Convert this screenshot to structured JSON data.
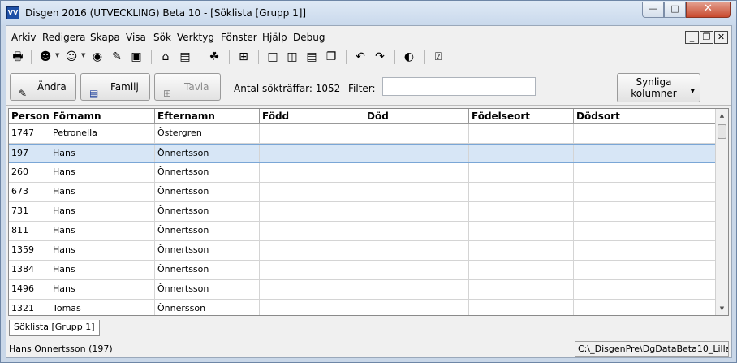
{
  "window": {
    "app_icon": "VV",
    "title": "Disgen 2016 (UTVECKLING) Beta 10 - [Söklista [Grupp 1]]"
  },
  "menu": [
    "Arkiv",
    "Redigera",
    "Skapa",
    "Visa",
    "Sök",
    "Verktyg",
    "Fönster",
    "Hjälp",
    "Debug"
  ],
  "actions": {
    "andra": "Ändra",
    "familj": "Familj",
    "tavla": "Tavla",
    "hits": "Antal sökträffar: 1052",
    "filter_label": "Filter:",
    "filter_value": "",
    "columns_line1": "Synliga",
    "columns_line2": "kolumner"
  },
  "grid": {
    "columns": [
      "Person",
      "Förnamn",
      "Efternamn",
      "Född",
      "Död",
      "Födelseort",
      "Dödsort"
    ],
    "rows": [
      [
        "1747",
        "Petronella",
        "Östergren",
        "",
        "",
        "",
        ""
      ],
      [
        "197",
        "Hans",
        "Önnertsson",
        "",
        "",
        "",
        ""
      ],
      [
        "260",
        "Hans",
        "Önnertsson",
        "",
        "",
        "",
        ""
      ],
      [
        "673",
        "Hans",
        "Önnertsson",
        "",
        "",
        "",
        ""
      ],
      [
        "731",
        "Hans",
        "Önnertsson",
        "",
        "",
        "",
        ""
      ],
      [
        "811",
        "Hans",
        "Önnertsson",
        "",
        "",
        "",
        ""
      ],
      [
        "1359",
        "Hans",
        "Önnertsson",
        "",
        "",
        "",
        ""
      ],
      [
        "1384",
        "Hans",
        "Önnertsson",
        "",
        "",
        "",
        ""
      ],
      [
        "1496",
        "Hans",
        "Önnertsson",
        "",
        "",
        "",
        ""
      ],
      [
        "1321",
        "Tomas",
        "Önnersson",
        "",
        "",
        "",
        ""
      ]
    ],
    "selected_row": 1
  },
  "tabs": [
    "Söklista [Grupp 1]"
  ],
  "status": {
    "left": "Hans Önnertsson  (197)",
    "right": "C:\\_DisgenPre\\DgDataBeta10_Lilla"
  }
}
